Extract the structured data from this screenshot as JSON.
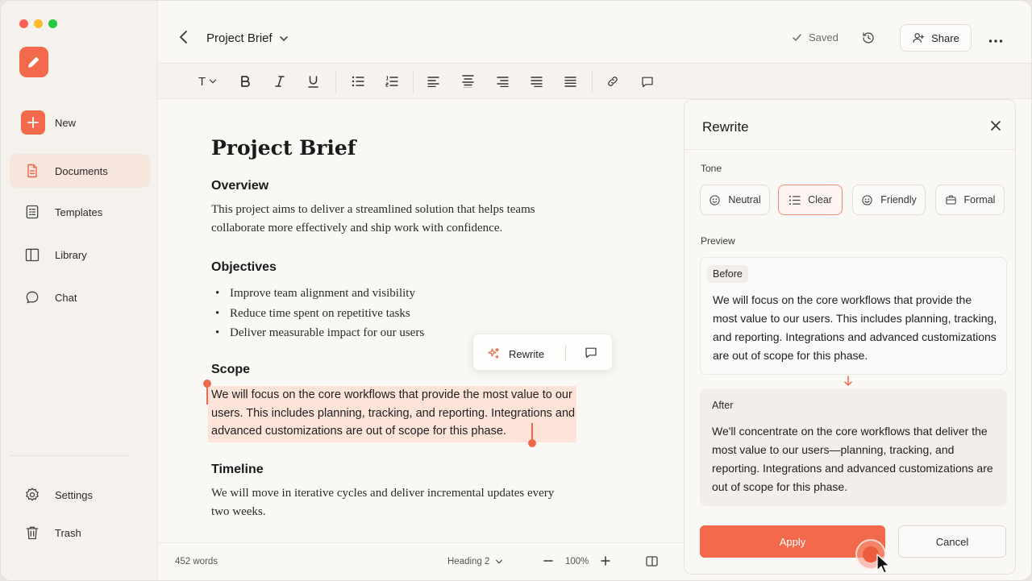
{
  "sidebar": {
    "new_label": "New",
    "items": [
      {
        "label": "Documents"
      },
      {
        "label": "Templates"
      },
      {
        "label": "Library"
      },
      {
        "label": "Chat"
      }
    ],
    "bottom_items": [
      {
        "label": "Settings"
      },
      {
        "label": "Trash"
      }
    ]
  },
  "header": {
    "doc_title": "Project Brief",
    "saved_label": "Saved",
    "share_label": "Share"
  },
  "toolbar": {
    "text_style_label": "T"
  },
  "document": {
    "title": "Project Brief",
    "overview_heading": "Overview",
    "overview_text": "This project aims to deliver a streamlined solution that helps teams collaborate more effectively and ship work with confidence.",
    "objectives_heading": "Objectives",
    "objectives": [
      "Improve team alignment and visibility",
      "Reduce time spent on repetitive tasks",
      "Deliver measurable impact for our users"
    ],
    "scope_heading": "Scope",
    "scope_text": "We will focus on the core workflows that provide the most value to our users. This includes planning, tracking, and reporting. Integrations and advanced customizations are out of scope for this phase.",
    "timeline_heading": "Timeline",
    "timeline_text": "We will move in iterative cycles and deliver incremental updates every two weeks."
  },
  "float_menu": {
    "rewrite_label": "Rewrite"
  },
  "status": {
    "word_count": "452 words",
    "style": "Heading 2",
    "zoom": "100%"
  },
  "rewrite_panel": {
    "title": "Rewrite",
    "tone_label": "Tone",
    "tones": [
      {
        "label": "Neutral",
        "selected": false
      },
      {
        "label": "Clear",
        "selected": true
      },
      {
        "label": "Friendly",
        "selected": false
      },
      {
        "label": "Formal",
        "selected": false
      }
    ],
    "preview_label": "Preview",
    "before_tag": "Before",
    "before_text": "We will focus on the core workflows that provide the most value to our users. This includes planning, tracking, and reporting. Integrations and advanced customizations are out of scope for this phase.",
    "after_tag": "After",
    "after_text": "We'll concentrate on the core workflows that deliver the most value to our users—planning, tracking, and reporting. Integrations and advanced customizations are out of scope for this phase.",
    "apply_label": "Apply",
    "cancel_label": "Cancel"
  },
  "colors": {
    "accent": "#f26a4b",
    "selection": "#fde3d8",
    "background": "#faf8f5"
  }
}
